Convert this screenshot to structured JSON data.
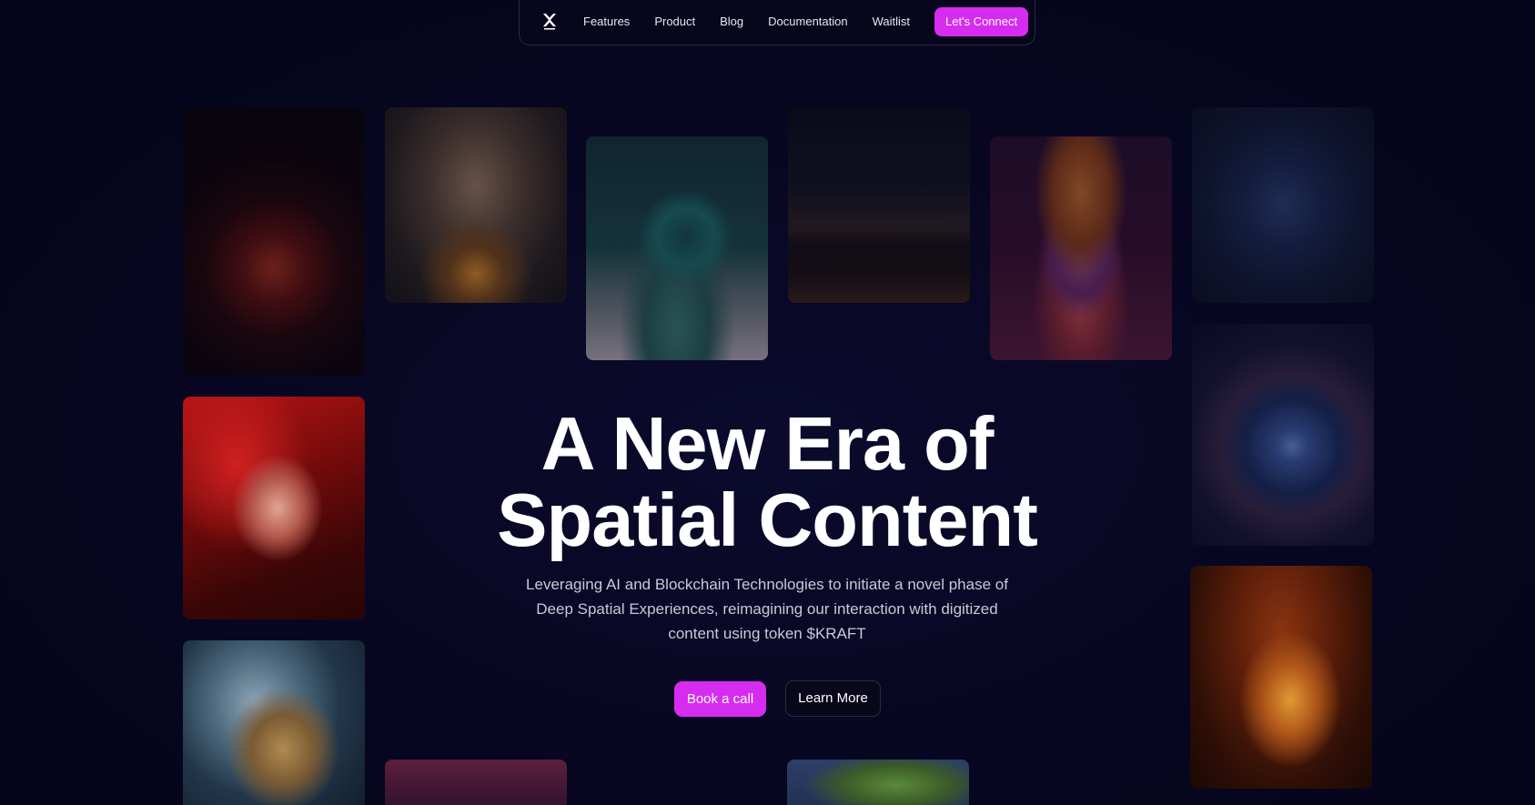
{
  "nav": {
    "logo_icon": "kraft-x-logo-icon",
    "links": [
      {
        "label": "Features"
      },
      {
        "label": "Product"
      },
      {
        "label": "Blog"
      },
      {
        "label": "Documentation"
      },
      {
        "label": "Waitlist"
      }
    ],
    "cta_label": "Let's Connect"
  },
  "hero": {
    "title_line1": "A New Era of",
    "title_line2": "Spatial Content",
    "subtitle": "Leveraging AI and Blockchain Technologies to initiate a novel phase of Deep Spatial Experiences, reimagining our interaction with digitized content using token $KRAFT",
    "primary_button": "Book a call",
    "secondary_button": "Learn More"
  },
  "colors": {
    "background": "#070620",
    "accent": "#d62cf0",
    "text": "#ffffff",
    "muted_text": "#c9c9d6"
  }
}
